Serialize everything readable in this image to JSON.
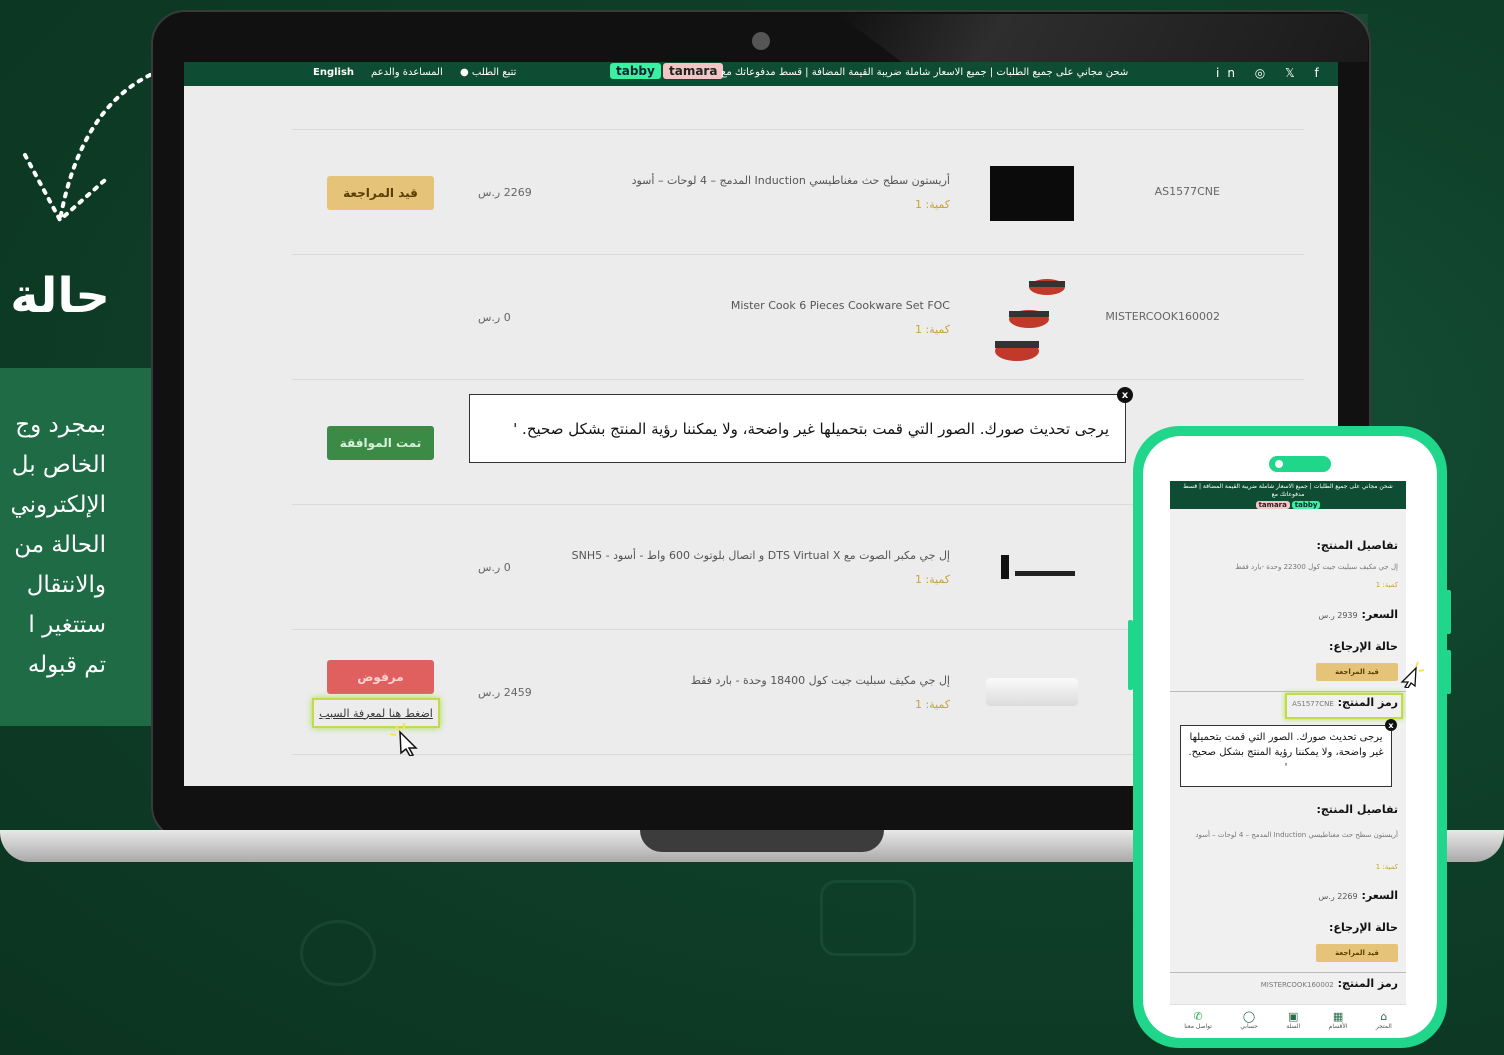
{
  "left": {
    "title": "حالة",
    "lines": [
      "بمجرد وج",
      "الخاص بل",
      "الإلكتروني",
      "الحالة من",
      "والانتقال",
      "ستتغير ا",
      "تم قبوله"
    ]
  },
  "topbar": {
    "lang": "English",
    "help": "المساعدة والدعم",
    "track": "تتبع الطلب",
    "promo": "شحن مجاني على جميع الطلبات | جميع الاسعار شاملة ضريبة القيمة المضافة | قسط مدفوعاتك مع",
    "tabby": "tabby",
    "tamara": "tamara",
    "social": "in ◎ 𝕏 f"
  },
  "rows": [
    {
      "code": "AS1577CNE",
      "name": "أريستون سطح حث مغناطيسي Induction المدمج – 4 لوحات – أسود",
      "qty": "كمية: 1",
      "price": "2269 ر.س",
      "status": "قيد المراجعة"
    },
    {
      "code": "MISTERCOOK160002",
      "name": "Mister Cook 6 Pieces Cookware Set FOC",
      "qty": "كمية: 1",
      "price": "0 ر.س",
      "status": ""
    },
    {
      "code": "",
      "name": "",
      "qty": "",
      "price": "",
      "status": "تمت الموافقة"
    },
    {
      "code": "",
      "name": "إل جي مكبر الصوت مع DTS Virtual X و اتصال بلوتوث 600 واط - أسود - SNH5",
      "qty": "كمية: 1",
      "price": "0 ر.س",
      "status": ""
    },
    {
      "code": "",
      "name": "إل جي مكيف سبليت جيت كول 18400 وحدة - بارد فقط",
      "qty": "كمية: 1",
      "price": "2459 ر.س",
      "status": "مرفوض",
      "link": "اضغط هنا لمعرفة السبب"
    }
  ],
  "popup": {
    "text": "يرجى تحديث صورك. الصور التي قمت بتحميلها غير واضحة، ولا يمكننا رؤية المنتج بشكل صحيح. '",
    "close": "x"
  },
  "phone": {
    "promo": "شحن مجاني على جميع الطلبات | جميع الاسعار شاملة ضريبة القيمة المضافة | قسط مدفوعاتك مع",
    "details_label": "تفاصيل المنتج:",
    "item1": "إل جي مكيف سبليت جيت كول 22300 وحدة -بارد فقط",
    "qty": "كمية: 1",
    "price_label": "السعر:",
    "price1": "2939 ر.س",
    "return_label": "حالة الإرجاع:",
    "status": "قيد المراجعة",
    "code_label": "رمز المنتج:",
    "code1": "AS1577CNE",
    "popup": "يرجى تحديث صورك. الصور التي قمت بتحميلها غير واضحة، ولا يمكننا رؤية المنتج بشكل صحيح. '",
    "item2": "أريستون سطح حث مغناطيسي Induction المدمج – 4 لوحات – أسود",
    "price2": "2269 ر.س",
    "code2": "MISTERCOOK160002",
    "nav": [
      "المتجر",
      "الأقسام",
      "السلة",
      "حسابي",
      "تواصل معنا"
    ]
  }
}
